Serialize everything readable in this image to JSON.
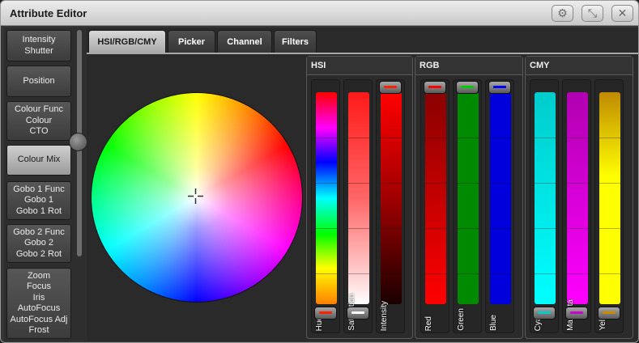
{
  "window": {
    "title": "Attribute Editor",
    "buttons": [
      {
        "icon": "gear-icon",
        "glyph": "⚙"
      },
      {
        "icon": "resize-icon",
        "glyph": "⤡"
      },
      {
        "icon": "close-icon",
        "glyph": "✕"
      }
    ]
  },
  "sidebar": {
    "items": [
      {
        "label": "Intensity\nShutter",
        "active": false
      },
      {
        "label": "Position",
        "active": false
      },
      {
        "label": "Colour Func\nColour\nCTO",
        "active": false
      },
      {
        "label": "Colour Mix",
        "active": true
      },
      {
        "label": "Gobo 1 Func\nGobo 1\nGobo 1 Rot",
        "active": false
      },
      {
        "label": "Gobo 2 Func\nGobo 2\nGobo 2 Rot",
        "active": false
      },
      {
        "label": "Zoom\nFocus\nIris\nAutoFocus\nAutoFocus Adj\nFrost",
        "active": false
      }
    ]
  },
  "tabs": [
    {
      "label": "HSI/RGB/CMY",
      "active": true
    },
    {
      "label": "Picker",
      "active": false
    },
    {
      "label": "Channel",
      "active": false
    },
    {
      "label": "Filters",
      "active": false
    }
  ],
  "groups": [
    {
      "title": "HSI"
    },
    {
      "title": "RGB"
    },
    {
      "title": "CMY"
    }
  ],
  "faders": [
    {
      "label": "Hue",
      "group": "HSI",
      "value": 0.01,
      "knob_color": "#ff2000"
    },
    {
      "label": "Saturation",
      "group": "HSI",
      "value": 0.01,
      "knob_color": "#ffffff"
    },
    {
      "label": "Intensity",
      "group": "HSI",
      "value": 1.0,
      "knob_color": "#ff2000"
    },
    {
      "label": "Red",
      "group": "RGB",
      "value": 1.0,
      "knob_color": "#ff0000"
    },
    {
      "label": "Green",
      "group": "RGB",
      "value": 1.0,
      "knob_color": "#00cc00"
    },
    {
      "label": "Blue",
      "group": "RGB",
      "value": 1.0,
      "knob_color": "#0000ff"
    },
    {
      "label": "Cyan",
      "group": "CMY",
      "value": 0.0,
      "knob_color": "#00cccc"
    },
    {
      "label": "Magenta",
      "group": "CMY",
      "value": 0.0,
      "knob_color": "#cc00cc"
    },
    {
      "label": "Yellow",
      "group": "CMY",
      "value": 0.0,
      "knob_color": "#cc8800"
    }
  ]
}
